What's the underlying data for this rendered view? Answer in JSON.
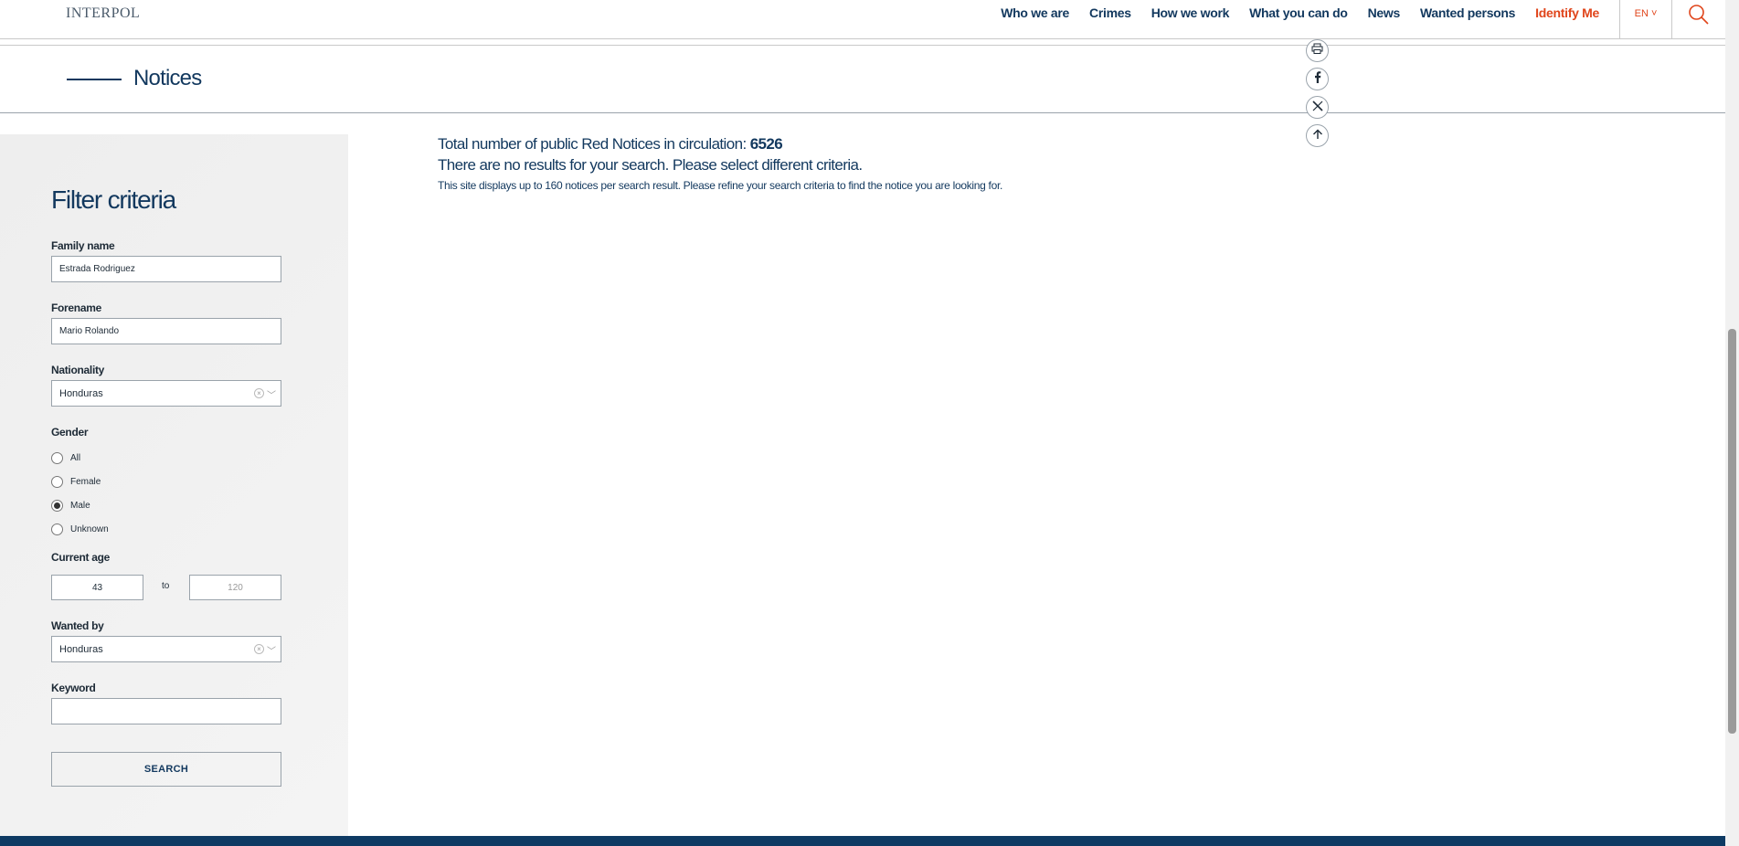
{
  "header": {
    "logo": "INTERPOL",
    "nav": [
      {
        "label": "Who we are"
      },
      {
        "label": "Crimes"
      },
      {
        "label": "How we work"
      },
      {
        "label": "What you can do"
      },
      {
        "label": "News"
      },
      {
        "label": "Wanted persons"
      },
      {
        "label": "Identify Me"
      }
    ],
    "language": "EN ˅"
  },
  "page": {
    "title": "Notices"
  },
  "filters": {
    "title": "Filter criteria",
    "family_name": {
      "label": "Family name",
      "value": "Estrada Rodriguez"
    },
    "forename": {
      "label": "Forename",
      "value": "Mario Rolando"
    },
    "nationality": {
      "label": "Nationality",
      "value": "Honduras"
    },
    "gender": {
      "label": "Gender",
      "options": [
        "All",
        "Female",
        "Male",
        "Unknown"
      ],
      "selected": "Male"
    },
    "age": {
      "label": "Current age",
      "min": "43",
      "to_label": "to",
      "max_placeholder": "120"
    },
    "wanted_by": {
      "label": "Wanted by",
      "value": "Honduras"
    },
    "keyword": {
      "label": "Keyword",
      "value": ""
    },
    "search_label": "SEARCH"
  },
  "results": {
    "total_prefix": "Total number of public Red Notices in circulation: ",
    "total_count": "6526",
    "no_results": "There are no results for your search. Please select different criteria.",
    "hint": "This site displays up to 160 notices per search result. Please refine your search criteria to find the notice you are looking for."
  },
  "colors": {
    "brand": "#12385e",
    "accent": "#e0451b",
    "footer": "#0e3a63"
  },
  "share_icons": [
    "print-icon",
    "facebook-icon",
    "x-icon",
    "back-to-top-icon"
  ]
}
